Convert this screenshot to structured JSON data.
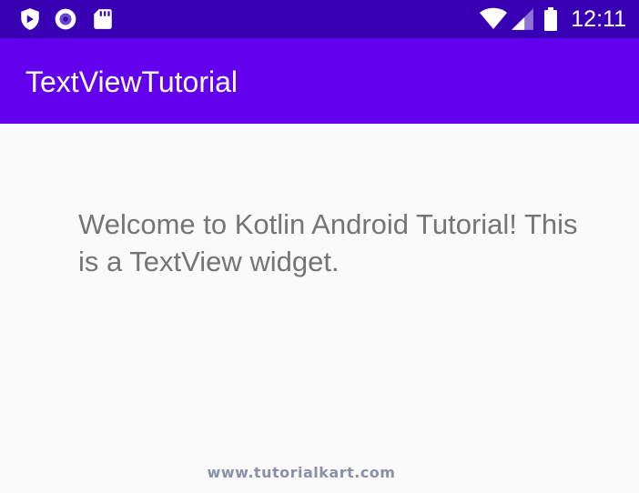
{
  "status_bar": {
    "time": "12:11",
    "icons": [
      "shield-icon",
      "record-icon",
      "sd-card-icon",
      "wifi-icon",
      "cell-signal-icon",
      "battery-icon"
    ]
  },
  "app_bar": {
    "title": "TextViewTutorial"
  },
  "content": {
    "text_view": "Welcome to Kotlin Android Tutorial! This is a TextView widget."
  },
  "watermark": "www.tutorialkart.com",
  "colors": {
    "status_bar": "#3700b3",
    "app_bar": "#6200ee",
    "background": "#fafafa",
    "text": "#757575"
  }
}
